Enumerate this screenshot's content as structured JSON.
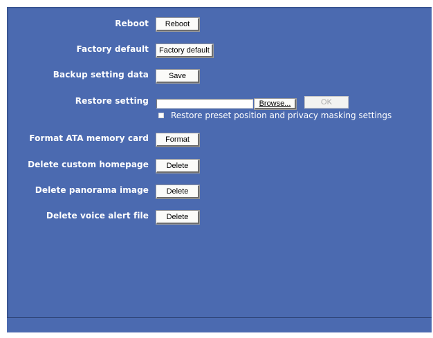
{
  "rows": {
    "reboot": {
      "label": "Reboot",
      "button": "Reboot"
    },
    "factory_default": {
      "label": "Factory default",
      "button": "Factory default"
    },
    "backup": {
      "label": "Backup setting data",
      "button": "Save"
    },
    "restore": {
      "label": "Restore setting",
      "file_value": "",
      "browse_button": "Browse...",
      "ok_button": "OK",
      "checkbox_label": "Restore preset position and privacy masking settings",
      "checkbox_checked": false
    },
    "format": {
      "label": "Format ATA memory card",
      "button": "Format"
    },
    "delete_homepage": {
      "label": "Delete custom homepage",
      "button": "Delete"
    },
    "delete_panorama": {
      "label": "Delete panorama image",
      "button": "Delete"
    },
    "delete_voice": {
      "label": "Delete voice alert file",
      "button": "Delete"
    }
  },
  "colors": {
    "panel_background": "#4b6ab0",
    "label_text": "#ffffff",
    "button_face": "#fbfbf9"
  }
}
